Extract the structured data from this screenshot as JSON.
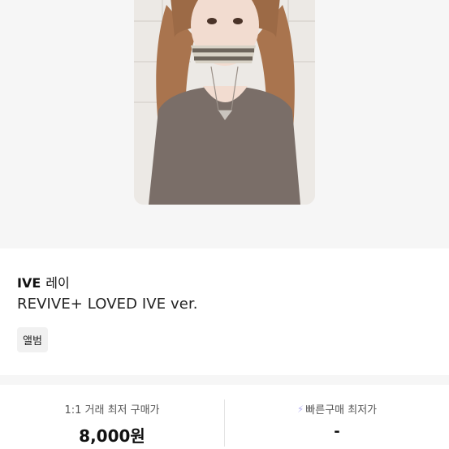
{
  "product": {
    "group": "IVE",
    "member": "레이",
    "album_version": "REVIVE+ LOVED IVE ver.",
    "tag": "앨범"
  },
  "prices": {
    "direct_label": "1:1 거래 최저 구매가",
    "direct_value": "8,000원",
    "quick_label": "빠른구매 최저가",
    "quick_value": "-"
  },
  "icons": {
    "quick_icon": "lightning-bolt-icon"
  }
}
